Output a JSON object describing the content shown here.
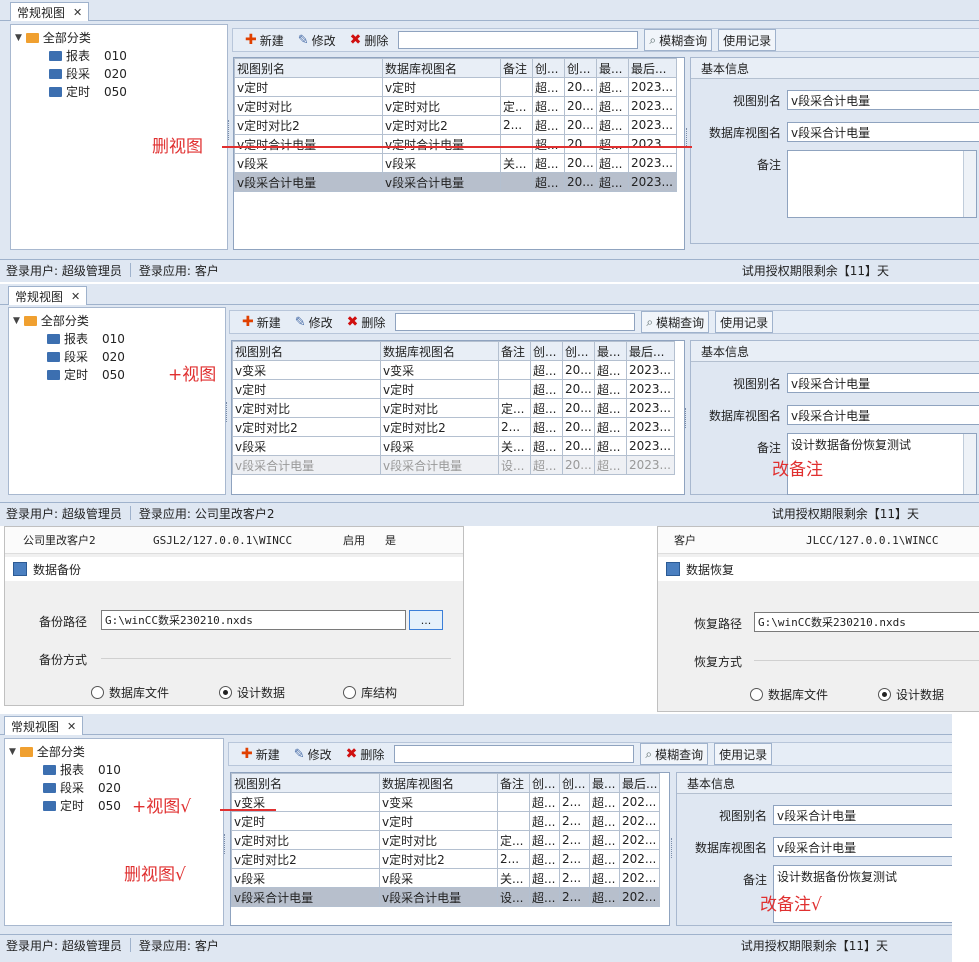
{
  "app": {
    "tab_label": "常规视图",
    "tab_close": "✕",
    "tree": {
      "root": "全部分类",
      "children": [
        {
          "name": "报表",
          "code": "010"
        },
        {
          "name": "段采",
          "code": "020"
        },
        {
          "name": "定时",
          "code": "050"
        }
      ]
    },
    "toolbar": {
      "new": "新建",
      "edit": "修改",
      "delete": "删除",
      "search_value": "",
      "fuzzy": "模糊查询",
      "usage_log": "使用记录"
    },
    "columns": [
      "视图别名",
      "数据库视图名",
      "备注",
      "创...",
      "创...",
      "最...",
      "最后..."
    ],
    "columns_narrow": [
      "视图别名",
      "数据库视图名",
      "备注",
      "创...",
      "创...",
      "最...",
      "最后..."
    ],
    "info": {
      "header": "基本信息",
      "alias_label": "视图别名",
      "dbname_label": "数据库视图名",
      "note_label": "备注",
      "alias_value": "v段采合计电量",
      "dbname_value": "v段采合计电量"
    },
    "status": {
      "user": "登录用户: 超级管理员",
      "app_label": "登录应用:",
      "license": "试用授权期限剩余【11】天"
    }
  },
  "panel1": {
    "rows": [
      [
        "v定时",
        "v定时",
        "",
        "超...",
        "20...",
        "超...",
        "2023..."
      ],
      [
        "v定时对比",
        "v定时对比",
        "定...",
        "超...",
        "20...",
        "超...",
        "2023..."
      ],
      [
        "v定时对比2",
        "v定时对比2",
        "2...",
        "超...",
        "20...",
        "超...",
        "2023..."
      ],
      [
        "v定时合计电量",
        "v定时合计电量",
        "",
        "超...",
        "20...",
        "超...",
        "2023..."
      ],
      [
        "v段采",
        "v段采",
        "关...",
        "超...",
        "20...",
        "超...",
        "2023..."
      ],
      [
        "v段采合计电量",
        "v段采合计电量",
        "",
        "超...",
        "20...",
        "超...",
        "2023..."
      ]
    ],
    "note_value": "",
    "status_app": "客户",
    "annotation": "删视图"
  },
  "panel2": {
    "rows": [
      [
        "v变采",
        "v变采",
        "",
        "超...",
        "20...",
        "超...",
        "2023..."
      ],
      [
        "v定时",
        "v定时",
        "",
        "超...",
        "20...",
        "超...",
        "2023..."
      ],
      [
        "v定时对比",
        "v定时对比",
        "定...",
        "超...",
        "20...",
        "超...",
        "2023..."
      ],
      [
        "v定时对比2",
        "v定时对比2",
        "2...",
        "超...",
        "20...",
        "超...",
        "2023..."
      ],
      [
        "v段采",
        "v段采",
        "关...",
        "超...",
        "20...",
        "超...",
        "2023..."
      ],
      [
        "v段采合计电量",
        "v段采合计电量",
        "设...",
        "超...",
        "20...",
        "超...",
        "2023..."
      ]
    ],
    "note_value": "设计数据备份恢复测试",
    "status_app": "公司里改客户2",
    "annotation_add": "+视图",
    "annotation_note": "改备注"
  },
  "backup": {
    "strip_name": "公司里改客户2",
    "strip_server": "GSJL2/127.0.0.1\\WINCC",
    "strip_enabled": "启用",
    "strip_yes": "是",
    "title": "数据备份",
    "path_label": "备份路径",
    "path_value": "G:\\winCC数采230210.nxds",
    "browse": "...",
    "mode_label": "备份方式",
    "opt1": "数据库文件",
    "opt2": "设计数据",
    "opt3": "库结构"
  },
  "restore": {
    "strip_name": "客户",
    "strip_server": "JLCC/127.0.0.1\\WINCC",
    "title": "数据恢复",
    "path_label": "恢复路径",
    "path_value": "G:\\winCC数采230210.nxds",
    "mode_label": "恢复方式",
    "opt1": "数据库文件",
    "opt2": "设计数据"
  },
  "panel3": {
    "rows": [
      [
        "v变采",
        "v变采",
        "",
        "超...",
        "2...",
        "超...",
        "202..."
      ],
      [
        "v定时",
        "v定时",
        "",
        "超...",
        "2...",
        "超...",
        "202..."
      ],
      [
        "v定时对比",
        "v定时对比",
        "定...",
        "超...",
        "2...",
        "超...",
        "202..."
      ],
      [
        "v定时对比2",
        "v定时对比2",
        "2...",
        "超...",
        "2...",
        "超...",
        "202..."
      ],
      [
        "v段采",
        "v段采",
        "关...",
        "超...",
        "2...",
        "超...",
        "202..."
      ],
      [
        "v段采合计电量",
        "v段采合计电量",
        "设...",
        "超...",
        "2...",
        "超...",
        "202..."
      ]
    ],
    "note_value": "设计数据备份恢复测试",
    "status_app": "客户",
    "annotation_add": "+视图√",
    "annotation_del": "删视图√",
    "annotation_note": "改备注√"
  },
  "colors": {
    "annotation_red": "#e03030",
    "selected_row": "#b7bfcc",
    "panel_bg": "#dfe7f2"
  }
}
